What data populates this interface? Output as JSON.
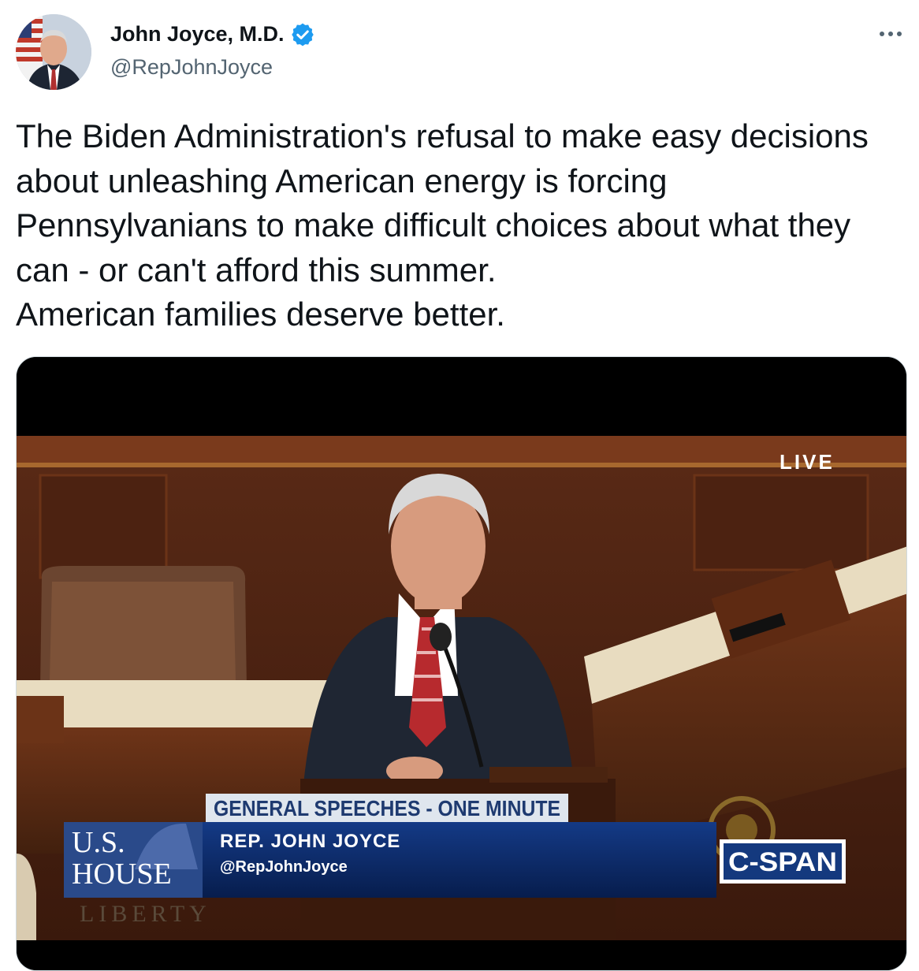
{
  "author": {
    "display_name": "John Joyce, M.D.",
    "handle": "@RepJohnJoyce",
    "verified": true,
    "avatar_icon": "profile-photo"
  },
  "tweet": {
    "text": "The Biden Administration's refusal to make easy decisions about unleashing American energy is forcing Pennsylvanians to make difficult choices about what they can - or can't afford this summer.\nAmerican families deserve better."
  },
  "video": {
    "live_label": "LIVE",
    "banner_title": "GENERAL SPEECHES - ONE MINUTE",
    "speaker_name": "REP. JOHN JOYCE",
    "speaker_handle": "@RepJohnJoyce",
    "house_logo_line1": "U.S.",
    "house_logo_line2": "HOUSE",
    "background_inscription": "LIBERTY",
    "network_logo": "C-SPAN"
  },
  "colors": {
    "verified_blue": "#1d9bf0",
    "handle_gray": "#536471",
    "banner_navy": "#0d2a66",
    "banner_title_bg": "#dfe6ee"
  },
  "icons": {
    "verified": "verified-badge-icon",
    "more": "more-options-icon"
  }
}
